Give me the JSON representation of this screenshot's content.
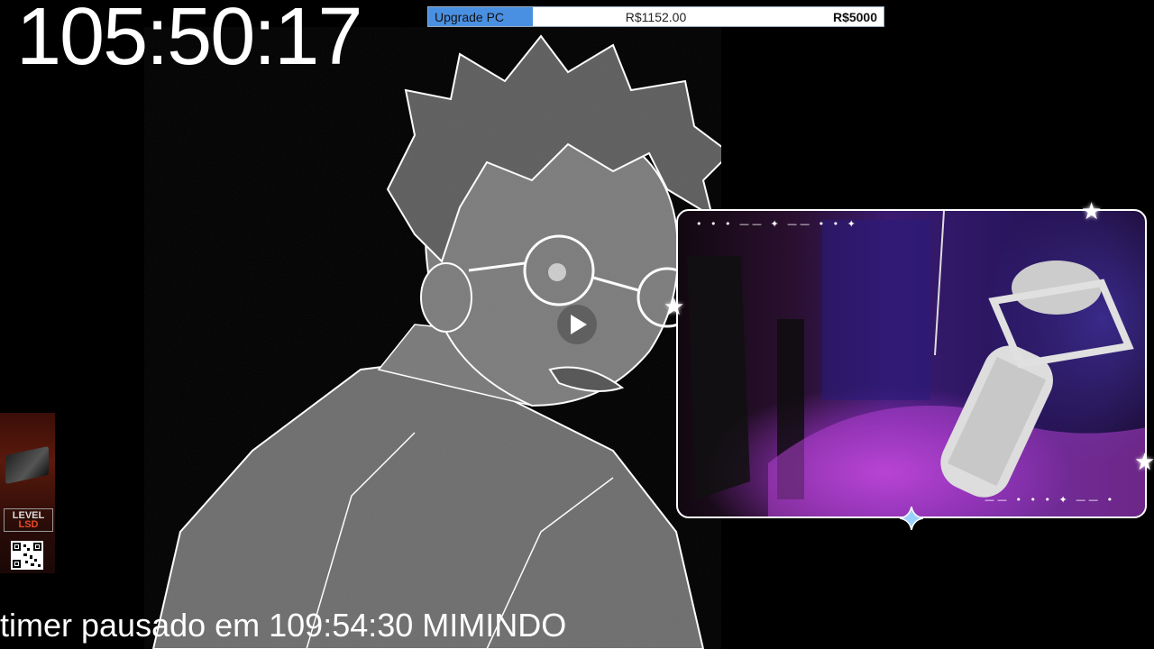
{
  "overlay": {
    "timer": "105:50:17",
    "status_text": "timer pausado em 109:54:30 MIMINDO"
  },
  "goal": {
    "label": "Upgrade PC",
    "current": "R$1152.00",
    "target": "R$5000",
    "progress": 0.2304,
    "fill_color": "#4a90e2"
  },
  "video": {
    "play_icon": "play-icon"
  },
  "webcam": {
    "decoration_top": "• • • —— ✦ —— • • ✦",
    "decoration_bottom": "—— • • • ✦ —— •",
    "star_icon": "star-icon",
    "diamond_icon": "sparkle-diamond-icon"
  },
  "sponsor": {
    "logo_line1": "LEVEL",
    "logo_line2": "LSD",
    "qr_icon": "qr-code-icon"
  },
  "colors": {
    "background": "#000000",
    "accent": "#4a90e2",
    "brand_red": "#e84a2a"
  }
}
